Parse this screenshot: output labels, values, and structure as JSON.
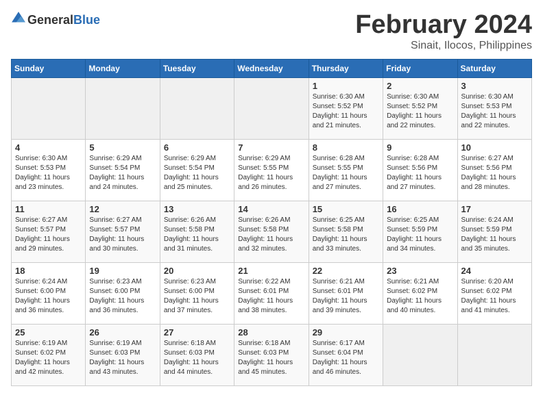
{
  "header": {
    "logo_general": "General",
    "logo_blue": "Blue",
    "month_title": "February 2024",
    "location": "Sinait, Ilocos, Philippines"
  },
  "weekdays": [
    "Sunday",
    "Monday",
    "Tuesday",
    "Wednesday",
    "Thursday",
    "Friday",
    "Saturday"
  ],
  "weeks": [
    [
      {
        "day": "",
        "info": ""
      },
      {
        "day": "",
        "info": ""
      },
      {
        "day": "",
        "info": ""
      },
      {
        "day": "",
        "info": ""
      },
      {
        "day": "1",
        "info": "Sunrise: 6:30 AM\nSunset: 5:52 PM\nDaylight: 11 hours and 21 minutes."
      },
      {
        "day": "2",
        "info": "Sunrise: 6:30 AM\nSunset: 5:52 PM\nDaylight: 11 hours and 22 minutes."
      },
      {
        "day": "3",
        "info": "Sunrise: 6:30 AM\nSunset: 5:53 PM\nDaylight: 11 hours and 22 minutes."
      }
    ],
    [
      {
        "day": "4",
        "info": "Sunrise: 6:30 AM\nSunset: 5:53 PM\nDaylight: 11 hours and 23 minutes."
      },
      {
        "day": "5",
        "info": "Sunrise: 6:29 AM\nSunset: 5:54 PM\nDaylight: 11 hours and 24 minutes."
      },
      {
        "day": "6",
        "info": "Sunrise: 6:29 AM\nSunset: 5:54 PM\nDaylight: 11 hours and 25 minutes."
      },
      {
        "day": "7",
        "info": "Sunrise: 6:29 AM\nSunset: 5:55 PM\nDaylight: 11 hours and 26 minutes."
      },
      {
        "day": "8",
        "info": "Sunrise: 6:28 AM\nSunset: 5:55 PM\nDaylight: 11 hours and 27 minutes."
      },
      {
        "day": "9",
        "info": "Sunrise: 6:28 AM\nSunset: 5:56 PM\nDaylight: 11 hours and 27 minutes."
      },
      {
        "day": "10",
        "info": "Sunrise: 6:27 AM\nSunset: 5:56 PM\nDaylight: 11 hours and 28 minutes."
      }
    ],
    [
      {
        "day": "11",
        "info": "Sunrise: 6:27 AM\nSunset: 5:57 PM\nDaylight: 11 hours and 29 minutes."
      },
      {
        "day": "12",
        "info": "Sunrise: 6:27 AM\nSunset: 5:57 PM\nDaylight: 11 hours and 30 minutes."
      },
      {
        "day": "13",
        "info": "Sunrise: 6:26 AM\nSunset: 5:58 PM\nDaylight: 11 hours and 31 minutes."
      },
      {
        "day": "14",
        "info": "Sunrise: 6:26 AM\nSunset: 5:58 PM\nDaylight: 11 hours and 32 minutes."
      },
      {
        "day": "15",
        "info": "Sunrise: 6:25 AM\nSunset: 5:58 PM\nDaylight: 11 hours and 33 minutes."
      },
      {
        "day": "16",
        "info": "Sunrise: 6:25 AM\nSunset: 5:59 PM\nDaylight: 11 hours and 34 minutes."
      },
      {
        "day": "17",
        "info": "Sunrise: 6:24 AM\nSunset: 5:59 PM\nDaylight: 11 hours and 35 minutes."
      }
    ],
    [
      {
        "day": "18",
        "info": "Sunrise: 6:24 AM\nSunset: 6:00 PM\nDaylight: 11 hours and 36 minutes."
      },
      {
        "day": "19",
        "info": "Sunrise: 6:23 AM\nSunset: 6:00 PM\nDaylight: 11 hours and 36 minutes."
      },
      {
        "day": "20",
        "info": "Sunrise: 6:23 AM\nSunset: 6:00 PM\nDaylight: 11 hours and 37 minutes."
      },
      {
        "day": "21",
        "info": "Sunrise: 6:22 AM\nSunset: 6:01 PM\nDaylight: 11 hours and 38 minutes."
      },
      {
        "day": "22",
        "info": "Sunrise: 6:21 AM\nSunset: 6:01 PM\nDaylight: 11 hours and 39 minutes."
      },
      {
        "day": "23",
        "info": "Sunrise: 6:21 AM\nSunset: 6:02 PM\nDaylight: 11 hours and 40 minutes."
      },
      {
        "day": "24",
        "info": "Sunrise: 6:20 AM\nSunset: 6:02 PM\nDaylight: 11 hours and 41 minutes."
      }
    ],
    [
      {
        "day": "25",
        "info": "Sunrise: 6:19 AM\nSunset: 6:02 PM\nDaylight: 11 hours and 42 minutes."
      },
      {
        "day": "26",
        "info": "Sunrise: 6:19 AM\nSunset: 6:03 PM\nDaylight: 11 hours and 43 minutes."
      },
      {
        "day": "27",
        "info": "Sunrise: 6:18 AM\nSunset: 6:03 PM\nDaylight: 11 hours and 44 minutes."
      },
      {
        "day": "28",
        "info": "Sunrise: 6:18 AM\nSunset: 6:03 PM\nDaylight: 11 hours and 45 minutes."
      },
      {
        "day": "29",
        "info": "Sunrise: 6:17 AM\nSunset: 6:04 PM\nDaylight: 11 hours and 46 minutes."
      },
      {
        "day": "",
        "info": ""
      },
      {
        "day": "",
        "info": ""
      }
    ]
  ]
}
